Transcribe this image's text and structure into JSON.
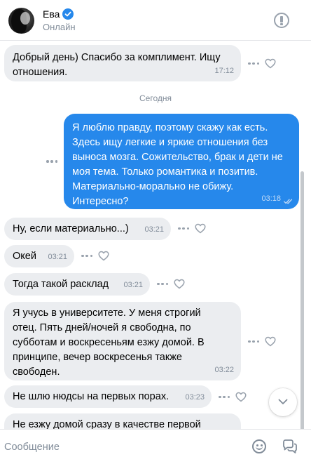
{
  "header": {
    "contact_name": "Ева",
    "status": "Онлайн"
  },
  "chat": {
    "date_divider": "Сегодня",
    "messages": [
      {
        "direction": "incoming",
        "text": "Добрый день) Спасибо за комплимент. Ищу\nотношения.",
        "time": "17:12"
      },
      {
        "direction": "outgoing",
        "text": "Я люблю правду, поэтому скажу как есть.\nЗдесь ищу легкие и яркие отношения без\nвыноса мозга. Сожительство, брак и дети не\nмоя тема. Только романтика и позитив.\nМатериально-морально не обижу.\nИнтересно?",
        "time": "03:18",
        "read": true
      },
      {
        "direction": "incoming",
        "text": "Ну, если материально...)",
        "time": "03:21"
      },
      {
        "direction": "incoming",
        "text": "Окей",
        "time": "03:21"
      },
      {
        "direction": "incoming",
        "text": "Тогда такой расклад",
        "time": "03:21"
      },
      {
        "direction": "incoming",
        "text": "Я учусь в университете. У меня строгий\nотец. Пять дней/ночей я свободна, по\nсубботам и воскресеньям езжу домой. В\nпринципе, вечер воскресенья также\nсвободен.",
        "time": "03:22"
      },
      {
        "direction": "incoming",
        "text": "Не шлю нюдсы на первых порах.",
        "time": "03:23"
      },
      {
        "direction": "incoming",
        "text": "Не езжу домой сразу в качестве первой",
        "time": ""
      }
    ]
  },
  "composer": {
    "placeholder": "Сообщение"
  },
  "colors": {
    "accent": "#2688eb",
    "incoming_bubble": "#ebedf0",
    "secondary_text": "#818c99"
  }
}
